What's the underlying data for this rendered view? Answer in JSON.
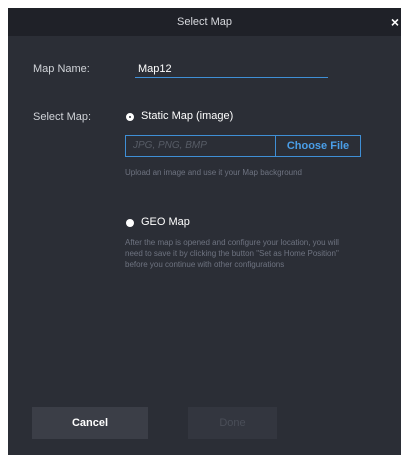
{
  "dialog": {
    "title": "Select Map",
    "close_symbol": "×"
  },
  "map_name": {
    "label": "Map Name:",
    "value": "Map12"
  },
  "select_map": {
    "label": "Select Map:",
    "static_option": {
      "label": "Static Map (image)",
      "selected": true
    },
    "file": {
      "placeholder": "JPG, PNG, BMP",
      "button_label": "Choose File",
      "help": "Upload an image and use it your Map background"
    },
    "geo_option": {
      "label": "GEO Map",
      "selected": false,
      "help_lines": [
        "After the map is opened and configure your location, you will",
        "need to save it by clicking the button \"Set as Home Position\"",
        "before you continue with other configurations"
      ]
    }
  },
  "footer": {
    "cancel_label": "Cancel",
    "done_label": "Done"
  },
  "colors": {
    "dialog_bg": "#2b2e36",
    "titlebar_bg": "#1f2128",
    "accent": "#3f8fd6",
    "link_text": "#4a9ee8"
  }
}
